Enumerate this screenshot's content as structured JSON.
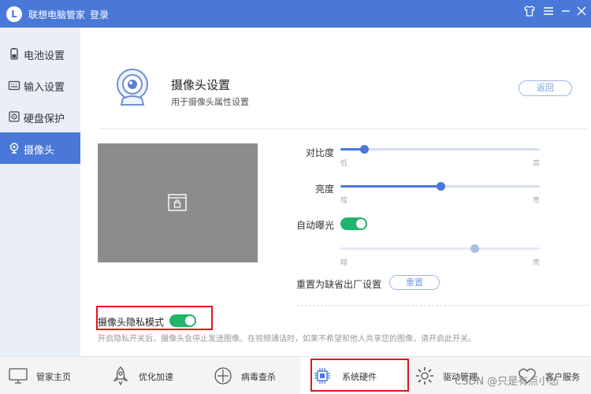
{
  "titlebar": {
    "logo_letter": "L",
    "app_title": "联想电脑管家",
    "login": "登录"
  },
  "sidebar": {
    "items": [
      {
        "label": "电池设置",
        "icon": "battery-icon"
      },
      {
        "label": "输入设置",
        "icon": "keyboard-icon"
      },
      {
        "label": "硬盘保护",
        "icon": "disk-icon"
      },
      {
        "label": "摄像头",
        "icon": "camera-icon",
        "active": true
      }
    ]
  },
  "header": {
    "title": "摄像头设置",
    "subtitle": "用于摄像头属性设置",
    "back": "返回"
  },
  "controls": {
    "contrast": {
      "label": "对比度",
      "low": "低",
      "high": "高",
      "value": 0.12
    },
    "brightness": {
      "label": "亮度",
      "low": "暗",
      "high": "亮",
      "value": 0.5
    },
    "auto_exposure": {
      "label": "自动曝光",
      "on": true
    },
    "exposure": {
      "low": "暗",
      "high": "亮",
      "value": 0.67
    },
    "reset_label": "重置为缺省出厂设置",
    "reset_button": "重置"
  },
  "privacy": {
    "label": "摄像头隐私模式",
    "on": true,
    "description": "开启隐私开关后，摄像头会停止发送图像。在视频通话时，如果不希望和他人共享您的图像，请开启此开关。"
  },
  "bottom_nav": [
    {
      "label": "管家主页",
      "icon": "monitor-icon"
    },
    {
      "label": "优化加速",
      "icon": "rocket-icon"
    },
    {
      "label": "病毒查杀",
      "icon": "shield-icon"
    },
    {
      "label": "系统硬件",
      "icon": "chip-icon",
      "active": true
    },
    {
      "label": "驱动管理",
      "icon": "gear-icon"
    },
    {
      "label": "客户服务",
      "icon": "heart-icon"
    }
  ],
  "watermark": "CSDN @只是有点小怂",
  "colors": {
    "accent": "#4a78d8",
    "toggle_on": "#1fb56b",
    "highlight": "#e0161c"
  }
}
